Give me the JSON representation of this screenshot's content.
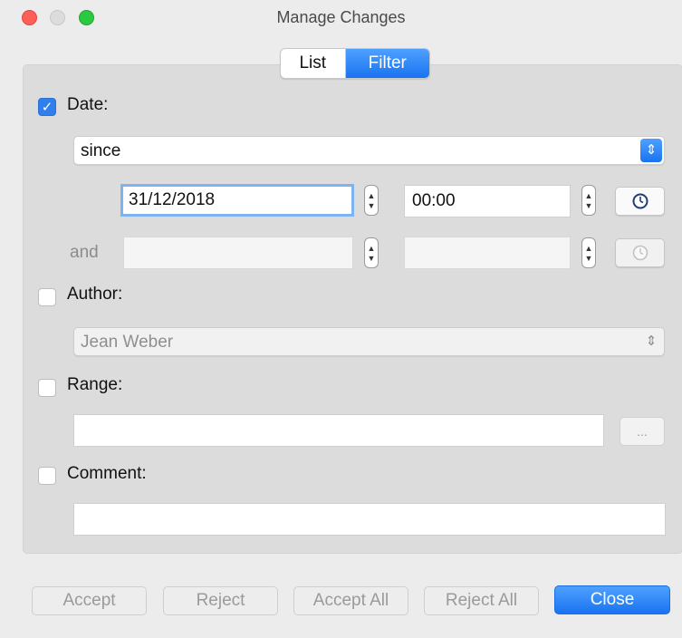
{
  "window": {
    "title": "Manage Changes"
  },
  "tabs": {
    "list_label": "List",
    "filter_label": "Filter"
  },
  "date": {
    "label": "Date:",
    "checked": true,
    "mode": "since",
    "date1": "31/12/2018",
    "time1": "00:00",
    "and_label": "and",
    "date2": "",
    "time2": ""
  },
  "author": {
    "label": "Author:",
    "value": "Jean Weber"
  },
  "range": {
    "label": "Range:",
    "value": "",
    "button_label": "..."
  },
  "comment": {
    "label": "Comment:",
    "value": ""
  },
  "buttons": {
    "accept": "Accept",
    "reject": "Reject",
    "accept_all": "Accept All",
    "reject_all": "Reject All",
    "close": "Close"
  },
  "colors": {
    "accent": "#1a73f0",
    "close_light": "#fe5f57",
    "max_light": "#2ac940"
  }
}
